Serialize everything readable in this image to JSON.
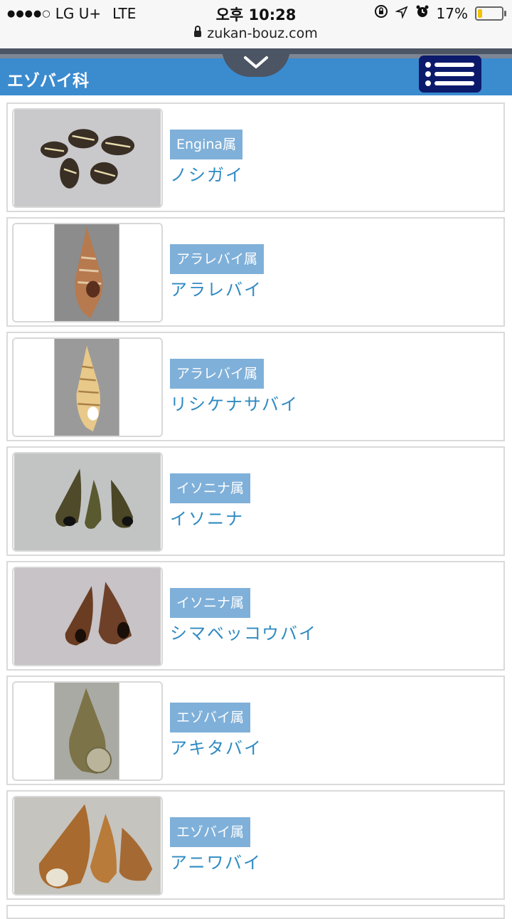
{
  "status_bar": {
    "signal_icon": "signal-dots-icon",
    "carrier": "LG U+",
    "network": "LTE",
    "time": "오후 10:28",
    "battery": "17%",
    "battery_level": 0.17,
    "battery_color": "#f2c200"
  },
  "browser": {
    "url": "zukan-bouz.com"
  },
  "header": {
    "title": "エゾバイ科",
    "color": "#3b8bcf"
  },
  "colors": {
    "menu_button": "#0b1a6b",
    "badge": "#7fb0d9",
    "name_text": "#2f8bc2"
  },
  "items": [
    {
      "genus": "Engina属",
      "name": "ノシガイ"
    },
    {
      "genus": "アラレバイ属",
      "name": "アラレバイ"
    },
    {
      "genus": "アラレバイ属",
      "name": "リシケナサバイ"
    },
    {
      "genus": "イソニナ属",
      "name": "イソニナ"
    },
    {
      "genus": "イソニナ属",
      "name": "シマベッコウバイ"
    },
    {
      "genus": "エゾバイ属",
      "name": "アキタバイ"
    },
    {
      "genus": "エゾバイ属",
      "name": "アニワバイ"
    }
  ]
}
